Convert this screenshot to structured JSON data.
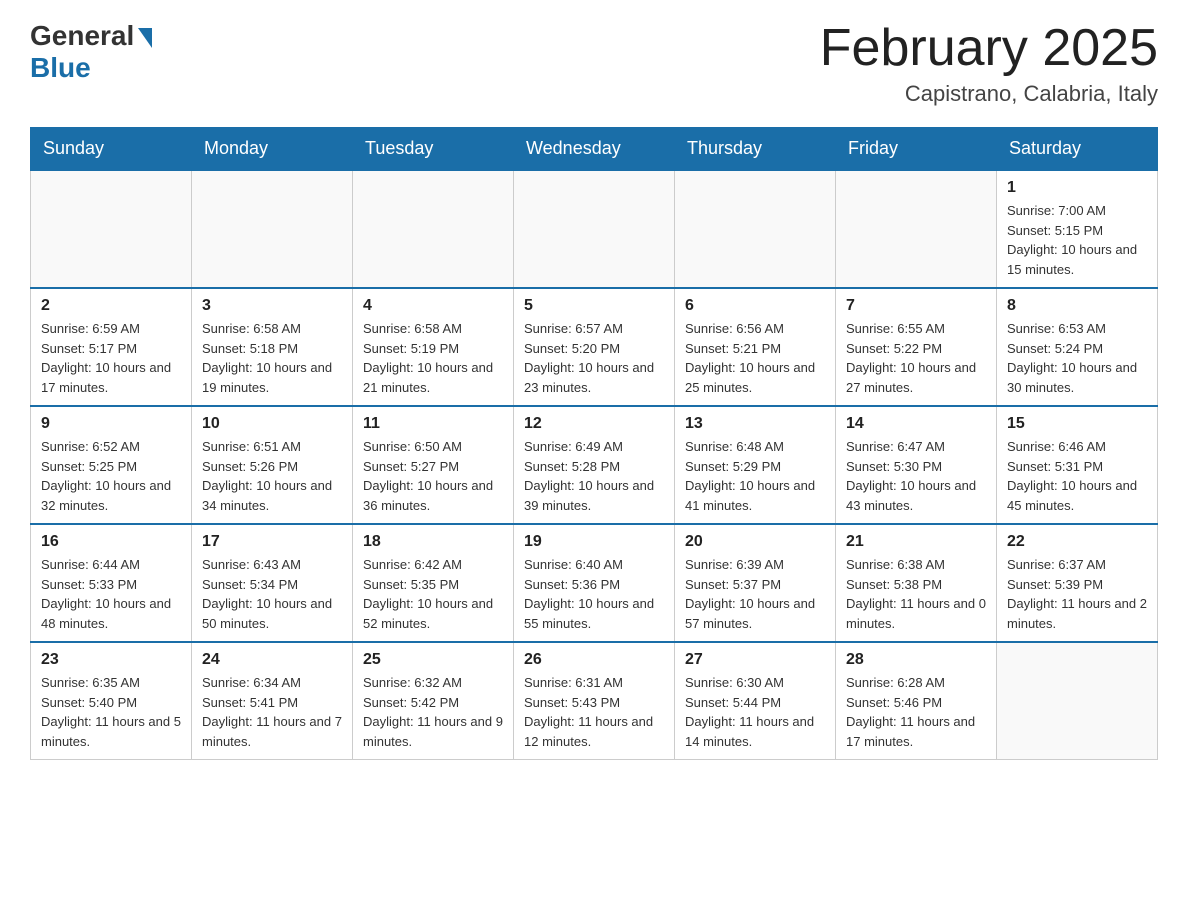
{
  "logo": {
    "general": "General",
    "blue": "Blue"
  },
  "title": {
    "month_year": "February 2025",
    "location": "Capistrano, Calabria, Italy"
  },
  "weekdays": [
    "Sunday",
    "Monday",
    "Tuesday",
    "Wednesday",
    "Thursday",
    "Friday",
    "Saturday"
  ],
  "weeks": [
    [
      {
        "day": "",
        "info": ""
      },
      {
        "day": "",
        "info": ""
      },
      {
        "day": "",
        "info": ""
      },
      {
        "day": "",
        "info": ""
      },
      {
        "day": "",
        "info": ""
      },
      {
        "day": "",
        "info": ""
      },
      {
        "day": "1",
        "info": "Sunrise: 7:00 AM\nSunset: 5:15 PM\nDaylight: 10 hours and 15 minutes."
      }
    ],
    [
      {
        "day": "2",
        "info": "Sunrise: 6:59 AM\nSunset: 5:17 PM\nDaylight: 10 hours and 17 minutes."
      },
      {
        "day": "3",
        "info": "Sunrise: 6:58 AM\nSunset: 5:18 PM\nDaylight: 10 hours and 19 minutes."
      },
      {
        "day": "4",
        "info": "Sunrise: 6:58 AM\nSunset: 5:19 PM\nDaylight: 10 hours and 21 minutes."
      },
      {
        "day": "5",
        "info": "Sunrise: 6:57 AM\nSunset: 5:20 PM\nDaylight: 10 hours and 23 minutes."
      },
      {
        "day": "6",
        "info": "Sunrise: 6:56 AM\nSunset: 5:21 PM\nDaylight: 10 hours and 25 minutes."
      },
      {
        "day": "7",
        "info": "Sunrise: 6:55 AM\nSunset: 5:22 PM\nDaylight: 10 hours and 27 minutes."
      },
      {
        "day": "8",
        "info": "Sunrise: 6:53 AM\nSunset: 5:24 PM\nDaylight: 10 hours and 30 minutes."
      }
    ],
    [
      {
        "day": "9",
        "info": "Sunrise: 6:52 AM\nSunset: 5:25 PM\nDaylight: 10 hours and 32 minutes."
      },
      {
        "day": "10",
        "info": "Sunrise: 6:51 AM\nSunset: 5:26 PM\nDaylight: 10 hours and 34 minutes."
      },
      {
        "day": "11",
        "info": "Sunrise: 6:50 AM\nSunset: 5:27 PM\nDaylight: 10 hours and 36 minutes."
      },
      {
        "day": "12",
        "info": "Sunrise: 6:49 AM\nSunset: 5:28 PM\nDaylight: 10 hours and 39 minutes."
      },
      {
        "day": "13",
        "info": "Sunrise: 6:48 AM\nSunset: 5:29 PM\nDaylight: 10 hours and 41 minutes."
      },
      {
        "day": "14",
        "info": "Sunrise: 6:47 AM\nSunset: 5:30 PM\nDaylight: 10 hours and 43 minutes."
      },
      {
        "day": "15",
        "info": "Sunrise: 6:46 AM\nSunset: 5:31 PM\nDaylight: 10 hours and 45 minutes."
      }
    ],
    [
      {
        "day": "16",
        "info": "Sunrise: 6:44 AM\nSunset: 5:33 PM\nDaylight: 10 hours and 48 minutes."
      },
      {
        "day": "17",
        "info": "Sunrise: 6:43 AM\nSunset: 5:34 PM\nDaylight: 10 hours and 50 minutes."
      },
      {
        "day": "18",
        "info": "Sunrise: 6:42 AM\nSunset: 5:35 PM\nDaylight: 10 hours and 52 minutes."
      },
      {
        "day": "19",
        "info": "Sunrise: 6:40 AM\nSunset: 5:36 PM\nDaylight: 10 hours and 55 minutes."
      },
      {
        "day": "20",
        "info": "Sunrise: 6:39 AM\nSunset: 5:37 PM\nDaylight: 10 hours and 57 minutes."
      },
      {
        "day": "21",
        "info": "Sunrise: 6:38 AM\nSunset: 5:38 PM\nDaylight: 11 hours and 0 minutes."
      },
      {
        "day": "22",
        "info": "Sunrise: 6:37 AM\nSunset: 5:39 PM\nDaylight: 11 hours and 2 minutes."
      }
    ],
    [
      {
        "day": "23",
        "info": "Sunrise: 6:35 AM\nSunset: 5:40 PM\nDaylight: 11 hours and 5 minutes."
      },
      {
        "day": "24",
        "info": "Sunrise: 6:34 AM\nSunset: 5:41 PM\nDaylight: 11 hours and 7 minutes."
      },
      {
        "day": "25",
        "info": "Sunrise: 6:32 AM\nSunset: 5:42 PM\nDaylight: 11 hours and 9 minutes."
      },
      {
        "day": "26",
        "info": "Sunrise: 6:31 AM\nSunset: 5:43 PM\nDaylight: 11 hours and 12 minutes."
      },
      {
        "day": "27",
        "info": "Sunrise: 6:30 AM\nSunset: 5:44 PM\nDaylight: 11 hours and 14 minutes."
      },
      {
        "day": "28",
        "info": "Sunrise: 6:28 AM\nSunset: 5:46 PM\nDaylight: 11 hours and 17 minutes."
      },
      {
        "day": "",
        "info": ""
      }
    ]
  ]
}
